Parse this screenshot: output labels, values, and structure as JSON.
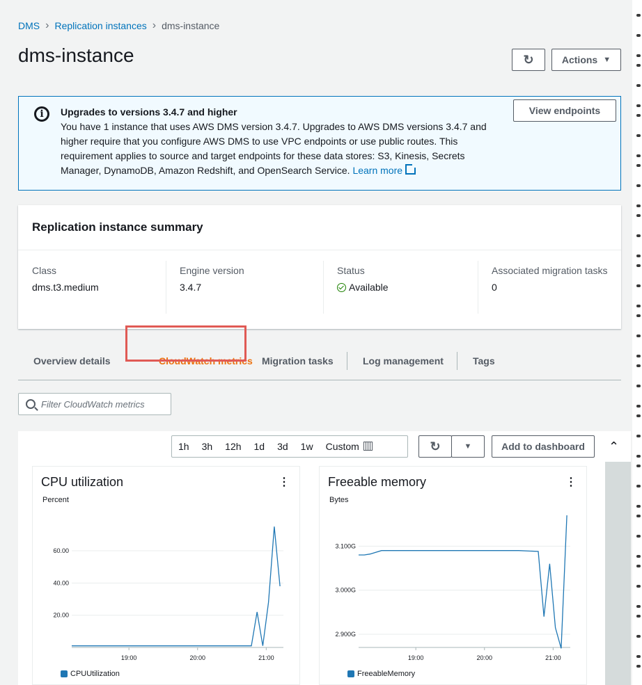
{
  "breadcrumb": {
    "root": "DMS",
    "parent": "Replication instances",
    "current": "dms-instance"
  },
  "page": {
    "title": "dms-instance",
    "refresh_icon": "refresh-icon",
    "actions_label": "Actions"
  },
  "alert": {
    "title": "Upgrades to versions 3.4.7 and higher",
    "body": "You have 1 instance that uses AWS DMS version 3.4.7. Upgrades to AWS DMS versions 3.4.7 and higher require that you configure AWS DMS to use VPC endpoints or use public routes. This requirement applies to source and target endpoints for these data stores: S3, Kinesis, Secrets Manager, DynamoDB, Amazon Redshift, and OpenSearch Service.",
    "link": "Learn more",
    "button": "View endpoints"
  },
  "summary": {
    "title": "Replication instance summary",
    "fields": [
      {
        "label": "Class",
        "value": "dms.t3.medium"
      },
      {
        "label": "Engine version",
        "value": "3.4.7"
      },
      {
        "label": "Status",
        "value": "Available"
      },
      {
        "label": "Associated migration tasks",
        "value": "0"
      }
    ],
    "status_color": "#1d8102"
  },
  "tabs": [
    "Overview details",
    "CloudWatch metrics",
    "Migration tasks",
    "Log management",
    "Tags"
  ],
  "active_tab": "CloudWatch metrics",
  "accent_color": "#ec7211",
  "filter": {
    "placeholder": "Filter CloudWatch metrics"
  },
  "metrics_toolbar": {
    "ranges": [
      "1h",
      "3h",
      "12h",
      "1d",
      "3d",
      "1w",
      "Custom"
    ],
    "add_label": "Add to dashboard"
  },
  "chart_data": [
    {
      "type": "line",
      "title": "CPU utilization",
      "ylabel": "Percent",
      "yticks": [
        "20.00",
        "40.00",
        "60.00"
      ],
      "ylim": [
        0,
        82
      ],
      "xticks": [
        "19:00",
        "20:00",
        "21:00"
      ],
      "series": [
        {
          "name": "CPUUtilization",
          "color": "#1f77b4",
          "x": [
            "18:10",
            "18:30",
            "19:00",
            "19:30",
            "20:00",
            "20:30",
            "20:47",
            "20:52",
            "20:57",
            "21:02",
            "21:07",
            "21:12"
          ],
          "values": [
            1,
            1,
            1,
            1,
            1,
            1,
            1,
            22,
            1,
            28,
            75,
            38
          ]
        }
      ]
    },
    {
      "type": "line",
      "title": "Freeable memory",
      "ylabel": "Bytes",
      "yticks": [
        "2.900G",
        "3.000G",
        "3.100G"
      ],
      "ylim": [
        2.87,
        3.17
      ],
      "xticks": [
        "19:00",
        "20:00",
        "21:00"
      ],
      "series": [
        {
          "name": "FreeableMemory",
          "color": "#1f77b4",
          "x": [
            "18:10",
            "18:15",
            "18:20",
            "18:30",
            "19:00",
            "19:30",
            "20:00",
            "20:30",
            "20:47",
            "20:52",
            "20:57",
            "21:02",
            "21:07",
            "21:12"
          ],
          "values": [
            3.08,
            3.08,
            3.082,
            3.09,
            3.09,
            3.09,
            3.09,
            3.09,
            3.088,
            2.94,
            3.06,
            2.915,
            2.868,
            3.17
          ]
        }
      ]
    }
  ]
}
